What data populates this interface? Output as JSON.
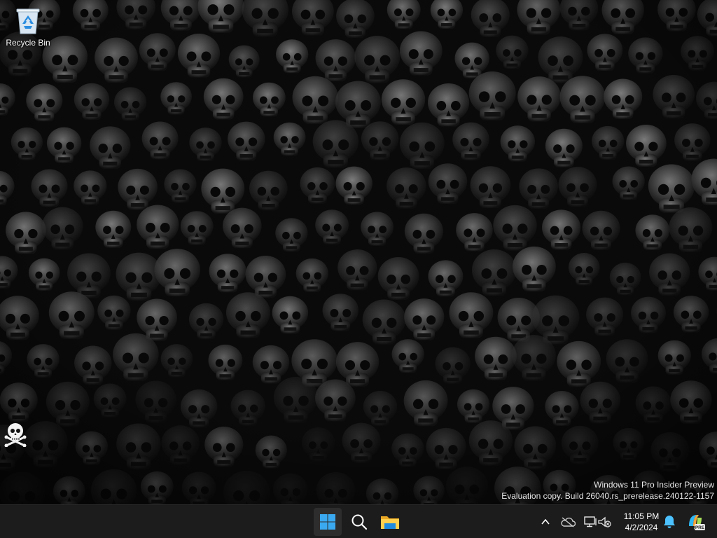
{
  "desktop": {
    "icons": [
      {
        "label": "Recycle Bin",
        "icon": "recycle-bin-icon"
      },
      {
        "label": "",
        "icon": "skull-crossbones-icon"
      }
    ],
    "wallpaper": "skulls"
  },
  "watermark": {
    "line1": "Windows 11 Pro Insider Preview",
    "line2": "Evaluation copy. Build 26040.rs_prerelease.240122-1157"
  },
  "taskbar": {
    "apps": [
      {
        "name": "start",
        "icon": "windows-logo-icon"
      },
      {
        "name": "search",
        "icon": "search-icon"
      },
      {
        "name": "file-explorer",
        "icon": "folder-icon"
      }
    ],
    "tray": {
      "icons": [
        "chevron-up-icon",
        "onedrive-icon",
        "network-icon",
        "volume-muted-icon"
      ],
      "clock": {
        "time": "11:05 PM",
        "date": "4/2/2024"
      },
      "notification_icon": "bell-icon",
      "pre_badge": "PRE"
    }
  },
  "colors": {
    "taskbar_bg": "#1c1c1c",
    "accent": "#3aa9f0",
    "bell": "#4cc2ff"
  }
}
